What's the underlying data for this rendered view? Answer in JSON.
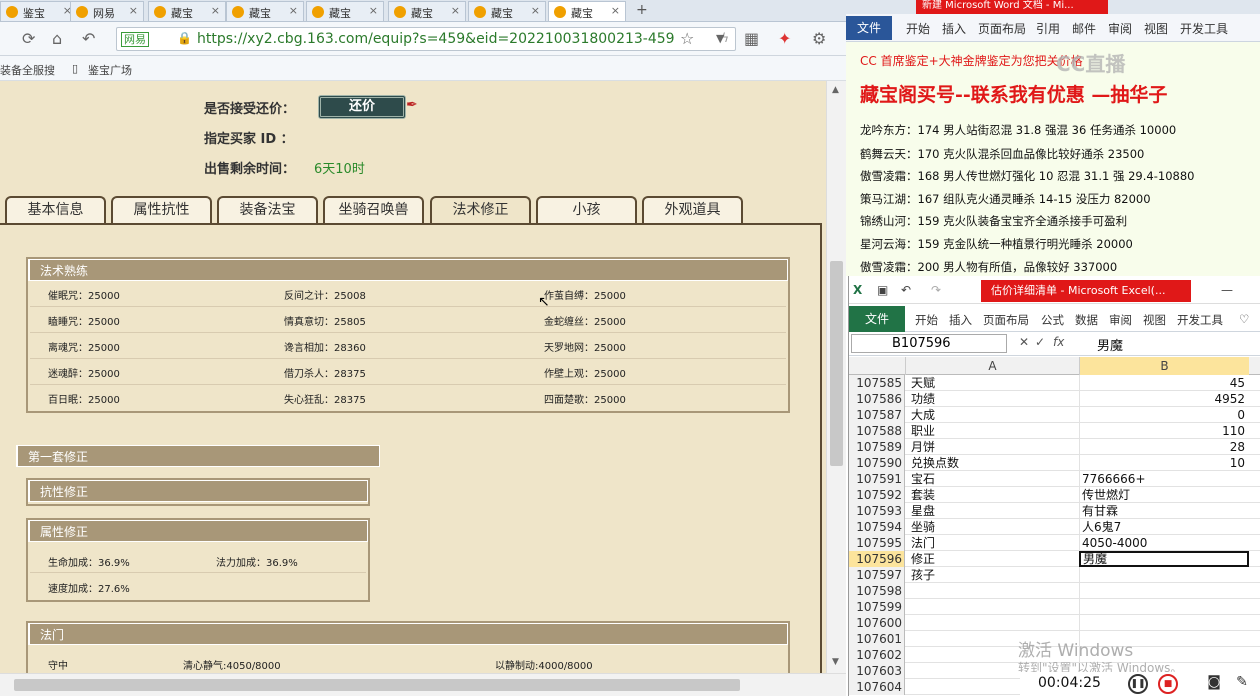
{
  "browser": {
    "tabs": [
      {
        "label": "鉴宝",
        "active": false
      },
      {
        "label": "网易",
        "active": false
      },
      {
        "label": "藏宝",
        "active": false
      },
      {
        "label": "藏宝",
        "active": false
      },
      {
        "label": "藏宝",
        "active": false
      },
      {
        "label": "藏宝",
        "active": false
      },
      {
        "label": "藏宝",
        "active": false
      },
      {
        "label": "藏宝",
        "active": true
      }
    ],
    "new_tab": "+",
    "address": {
      "site_badge": "网易",
      "url": "https://xy2.cbg.163.com/equip?s=459&eid=202210031800213-459"
    },
    "bookmarks": [
      "装备全服搜",
      "鉴宝广场"
    ]
  },
  "page": {
    "accept_counter_label": "是否接受还价：",
    "counter_button": "还价",
    "designated_buyer_label": "指定买家 ID ：",
    "time_left_label": "出售剩余时间：",
    "time_left_value": "6天10时",
    "tabs": [
      "基本信息",
      "属性抗性",
      "装备法宝",
      "坐骑召唤兽",
      "法术修正",
      "小孩",
      "外观道具"
    ],
    "active_tab": "法术修正",
    "spell_mastery": {
      "title": "法术熟练",
      "rows": [
        [
          "催眠咒：25000",
          "反间之计：25008",
          "作茧自缚：25000"
        ],
        [
          "瞌睡咒：25000",
          "情真意切：25805",
          "金蛇缠丝：25000"
        ],
        [
          "离魂咒：25000",
          "谗言相加：28360",
          "天罗地网：25000"
        ],
        [
          "迷魂醉：25000",
          "借刀杀人：28375",
          "作壁上观：25000"
        ],
        [
          "百日眠：25000",
          "失心狂乱：28375",
          "四面楚歌：25000"
        ]
      ]
    },
    "set1_title": "第一套修正",
    "resist_title": "抗性修正",
    "attr_title": "属性修正",
    "attr_rows": [
      [
        "生命加成：36.9%",
        "法力加成：36.9%"
      ],
      [
        "速度加成：27.6%",
        ""
      ]
    ],
    "fa_men": {
      "title": "法门",
      "cells": [
        "守中",
        "清心静气:4050/8000",
        "以静制动:4000/8000"
      ]
    }
  },
  "word": {
    "title": "新建 Microsoft Word 文档 - Mi...",
    "file_tab": "文件",
    "tabs": [
      "开始",
      "插入",
      "页面布局",
      "引用",
      "邮件",
      "审阅",
      "视图",
      "开发工具"
    ],
    "line1": "CC 首席鉴定+大神金牌鉴定为您把关价格",
    "headline": "藏宝阁买号--联系我有优惠 —抽华子",
    "lines": [
      "龙吟东方：174 男人站街忍混 31.8 强混 36 任务通杀 10000",
      "鹤舞云天：170 克火队混杀回血品像比较好通杀 23500",
      "傲雪凌霜：168 男人传世燃灯强化 10 忍混 31.1 强 29.4-10880",
      "策马江湖：167 组队克火通灵睡杀 14-15 没压力 82000",
      "锦绣山河：159 克火队装备宝宝齐全通杀接手可盈利",
      "星河云海：159 克金队统一种植景行明光睡杀 20000",
      "傲雪凌霜：200 男人物有所值，品像较好 337000"
    ],
    "watermark": "CC直播"
  },
  "excel": {
    "title": "估价详细清单 - Microsoft Excel(...",
    "file_tab": "文件",
    "tabs": [
      "开始",
      "插入",
      "页面布局",
      "公式",
      "数据",
      "审阅",
      "视图",
      "开发工具"
    ],
    "name_box": "B107596",
    "formula_value": "男魔",
    "col_a": "A",
    "col_b": "B",
    "rows": [
      {
        "n": "107585",
        "a": "天赋",
        "b": "45",
        "num": true
      },
      {
        "n": "107586",
        "a": "功绩",
        "b": "4952",
        "num": true
      },
      {
        "n": "107587",
        "a": "大成",
        "b": "0",
        "num": true
      },
      {
        "n": "107588",
        "a": "职业",
        "b": "110",
        "num": true
      },
      {
        "n": "107589",
        "a": "月饼",
        "b": "28",
        "num": true
      },
      {
        "n": "107590",
        "a": "兑换点数",
        "b": "10",
        "num": true
      },
      {
        "n": "107591",
        "a": "宝石",
        "b": "7766666+",
        "num": false
      },
      {
        "n": "107592",
        "a": "套装",
        "b": "传世燃灯",
        "num": false
      },
      {
        "n": "107593",
        "a": "星盘",
        "b": "有甘霖",
        "num": false
      },
      {
        "n": "107594",
        "a": "坐骑",
        "b": "人6鬼7",
        "num": false
      },
      {
        "n": "107595",
        "a": "法门",
        "b": "4050-4000",
        "num": false
      },
      {
        "n": "107596",
        "a": "修正",
        "b": "男魔",
        "num": false,
        "selected": true
      },
      {
        "n": "107597",
        "a": "孩子",
        "b": "",
        "num": false
      },
      {
        "n": "107598",
        "a": "",
        "b": "",
        "num": false
      },
      {
        "n": "107599",
        "a": "",
        "b": "",
        "num": false
      },
      {
        "n": "107600",
        "a": "",
        "b": "",
        "num": false
      },
      {
        "n": "107601",
        "a": "",
        "b": "",
        "num": false
      },
      {
        "n": "107602",
        "a": "",
        "b": "",
        "num": false
      },
      {
        "n": "107603",
        "a": "",
        "b": "",
        "num": false
      },
      {
        "n": "107604",
        "a": "",
        "b": "",
        "num": false
      }
    ]
  },
  "overlay": {
    "activation": "激活 Windows",
    "activation_sub": "转到\"设置\"以激活 Windows。",
    "rec_time": "00:04:25"
  }
}
